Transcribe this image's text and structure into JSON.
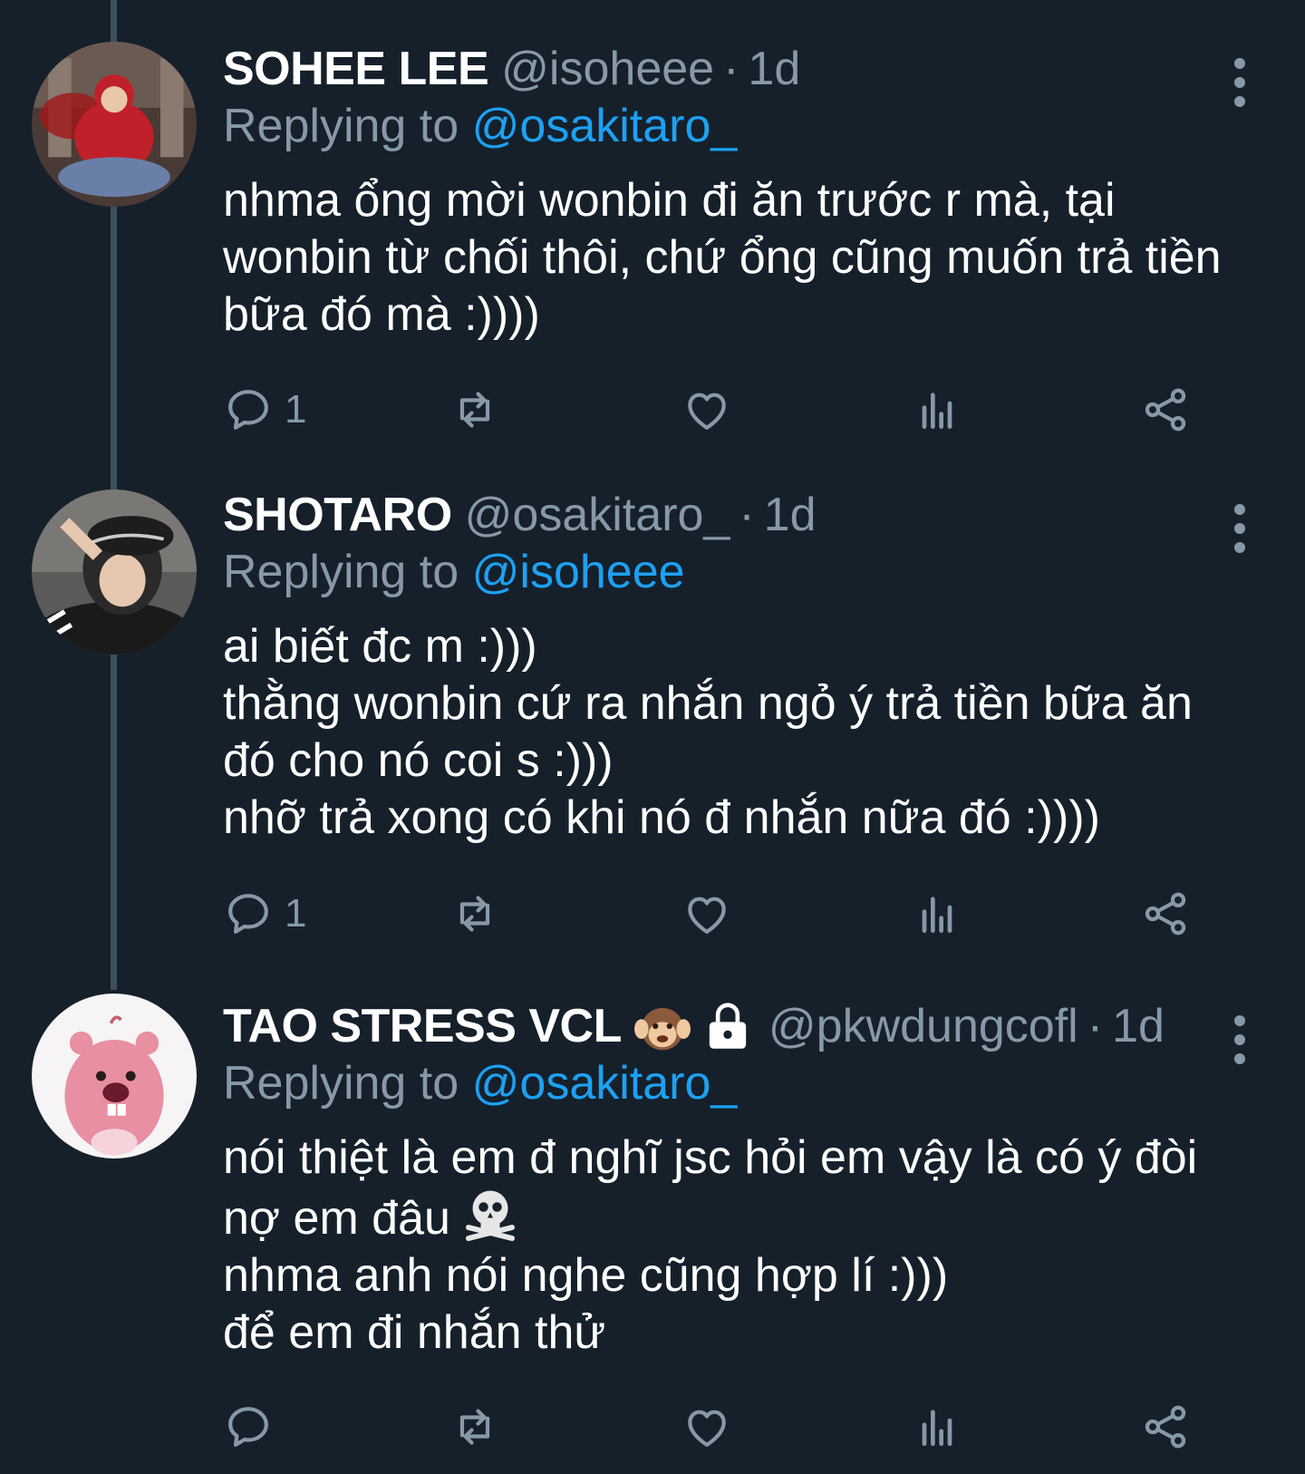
{
  "tweets": [
    {
      "name": "SOHEE LEE",
      "handle": "@isoheee",
      "separator": "·",
      "time": "1d",
      "replying_prefix": "Replying to",
      "replying_to": "@osakitaro_",
      "body": "nhma ổng mời wonbin đi ăn trước r mà, tại\nwonbin từ chối thôi, chứ ổng cũng muốn trả tiền\nbữa đó mà :))))",
      "reply_count": "1",
      "avatar_icon": "avatar-red-hoodie"
    },
    {
      "name": "SHOTARO",
      "handle": "@osakitaro_",
      "separator": "·",
      "time": "1d",
      "replying_prefix": "Replying to",
      "replying_to": "@isoheee",
      "body": "ai biết đc m :)))\nthằng wonbin cứ ra nhắn ngỏ ý trả tiền bữa ăn\nđó cho nó coi s :)))\nnhỡ trả xong có khi nó đ nhắn nữa đó :))))",
      "reply_count": "1",
      "avatar_icon": "avatar-bandana-cap"
    },
    {
      "name": "TAO STRESS VCL",
      "name_emojis": [
        "hear-no-evil-monkey-icon",
        "lock-icon"
      ],
      "handle": "@pkwdungcofl",
      "separator": "·",
      "time": "1d",
      "replying_prefix": "Replying to",
      "replying_to": "@osakitaro_",
      "body": "nói thiệt là em đ nghĩ jsc hỏi em vậy là có ý đòi\nnợ em đâu ",
      "body_rest": "\nnhma anh nói nghe cũng hợp lí :)))\nđể em đi nhắn thử",
      "body_emoji": "skull-crossbones-icon",
      "reply_count": "",
      "avatar_icon": "avatar-pink-beaver"
    }
  ],
  "colors": {
    "background": "#15202b",
    "secondary_text": "#8899a6",
    "mention": "#1da1f2",
    "thread_line": "#3d4f5d"
  },
  "action_icons": [
    "reply-icon",
    "retweet-icon",
    "like-icon",
    "analytics-icon",
    "share-icon"
  ]
}
